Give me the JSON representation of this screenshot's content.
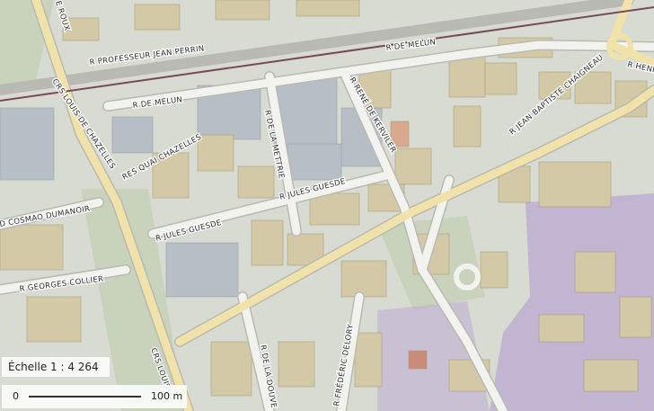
{
  "map": {
    "scale_text": "Échelle 1 : 4 264",
    "scale_bar": {
      "start": "0",
      "end": "100 m"
    },
    "colors": {
      "background": "#d9dcd3",
      "road": "#f2f2ee",
      "major_road": "#f3e7b6",
      "building": "#cfc5a6",
      "industrial": "#b9c0c7",
      "residential_zone": "#b9a6cf",
      "railway": "#7a4a5a",
      "park": "#c7d0b6"
    },
    "street_labels": [
      "E ROUX",
      "R PROFESSEUR JEAN PERRIN",
      "R DE MELUN",
      "R DE MELUN",
      "R HENRI S",
      "CRS LOUIS DE CHAZELLES",
      "R RENÉ DE KERVILER",
      "R JEAN BAPTISTE CHAIGNEAU",
      "R DE LA METTRIE",
      "RES QUAI CHAZELLES",
      "R JULES GUESDE",
      "R JULES GUESDE",
      "D COSMAO DUMANOIR",
      "R GEORGES COLLIER",
      "CRS LOUIS",
      "R DE LA DOUVE",
      "R FRÉDÉRIC DELORY"
    ]
  }
}
